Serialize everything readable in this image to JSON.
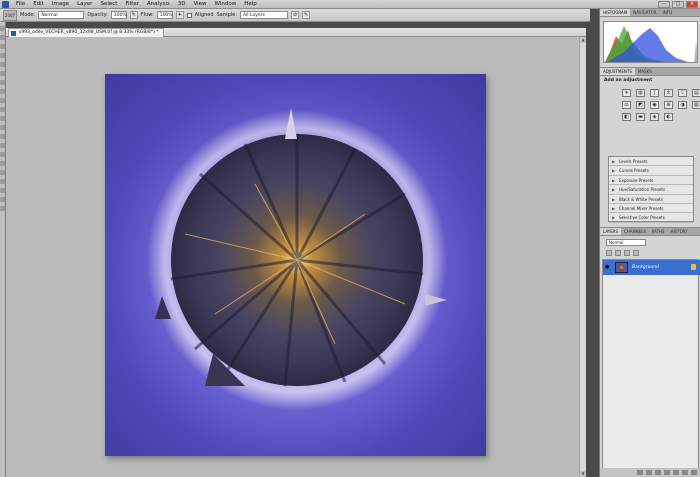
{
  "menubar": {
    "items": [
      "File",
      "Edit",
      "Image",
      "Layer",
      "Select",
      "Filter",
      "Analysis",
      "3D",
      "View",
      "Window",
      "Help"
    ]
  },
  "options": {
    "tool_preset": "2007",
    "mode_label": "Mode:",
    "mode_value": "Normal",
    "opacity_label": "Opacity:",
    "opacity_value": "100%",
    "flow_label": "Flow:",
    "flow_value": "100%",
    "aligned_label": "Aligned",
    "sample_label": "Sample:",
    "sample_value": "All Layers"
  },
  "document": {
    "tab_title": "s993_odile_VECHER_v890_32x98_USM.tif @ 8.33% (RGB/8*) *"
  },
  "histogram_panel": {
    "tabs": [
      "HISTOGRAM",
      "NAVIGATOR",
      "INFO"
    ]
  },
  "adjustments_panel": {
    "tabs": [
      "ADJUSTMENTS",
      "MASKS"
    ],
    "title": "Add an adjustment",
    "presets": [
      "Levels Presets",
      "Curves Presets",
      "Exposure Presets",
      "Hue/Saturation Presets",
      "Black & White Presets",
      "Channel Mixer Presets",
      "Selective Color Presets"
    ]
  },
  "layers_panel": {
    "tabs": [
      "LAYERS",
      "CHANNELS",
      "PATHS",
      "HISTORY"
    ],
    "blend_mode": "Normal",
    "layer_name": "Background"
  },
  "colors": {
    "accent": "#3a6fd0",
    "photo_sky": "#5048b6"
  }
}
